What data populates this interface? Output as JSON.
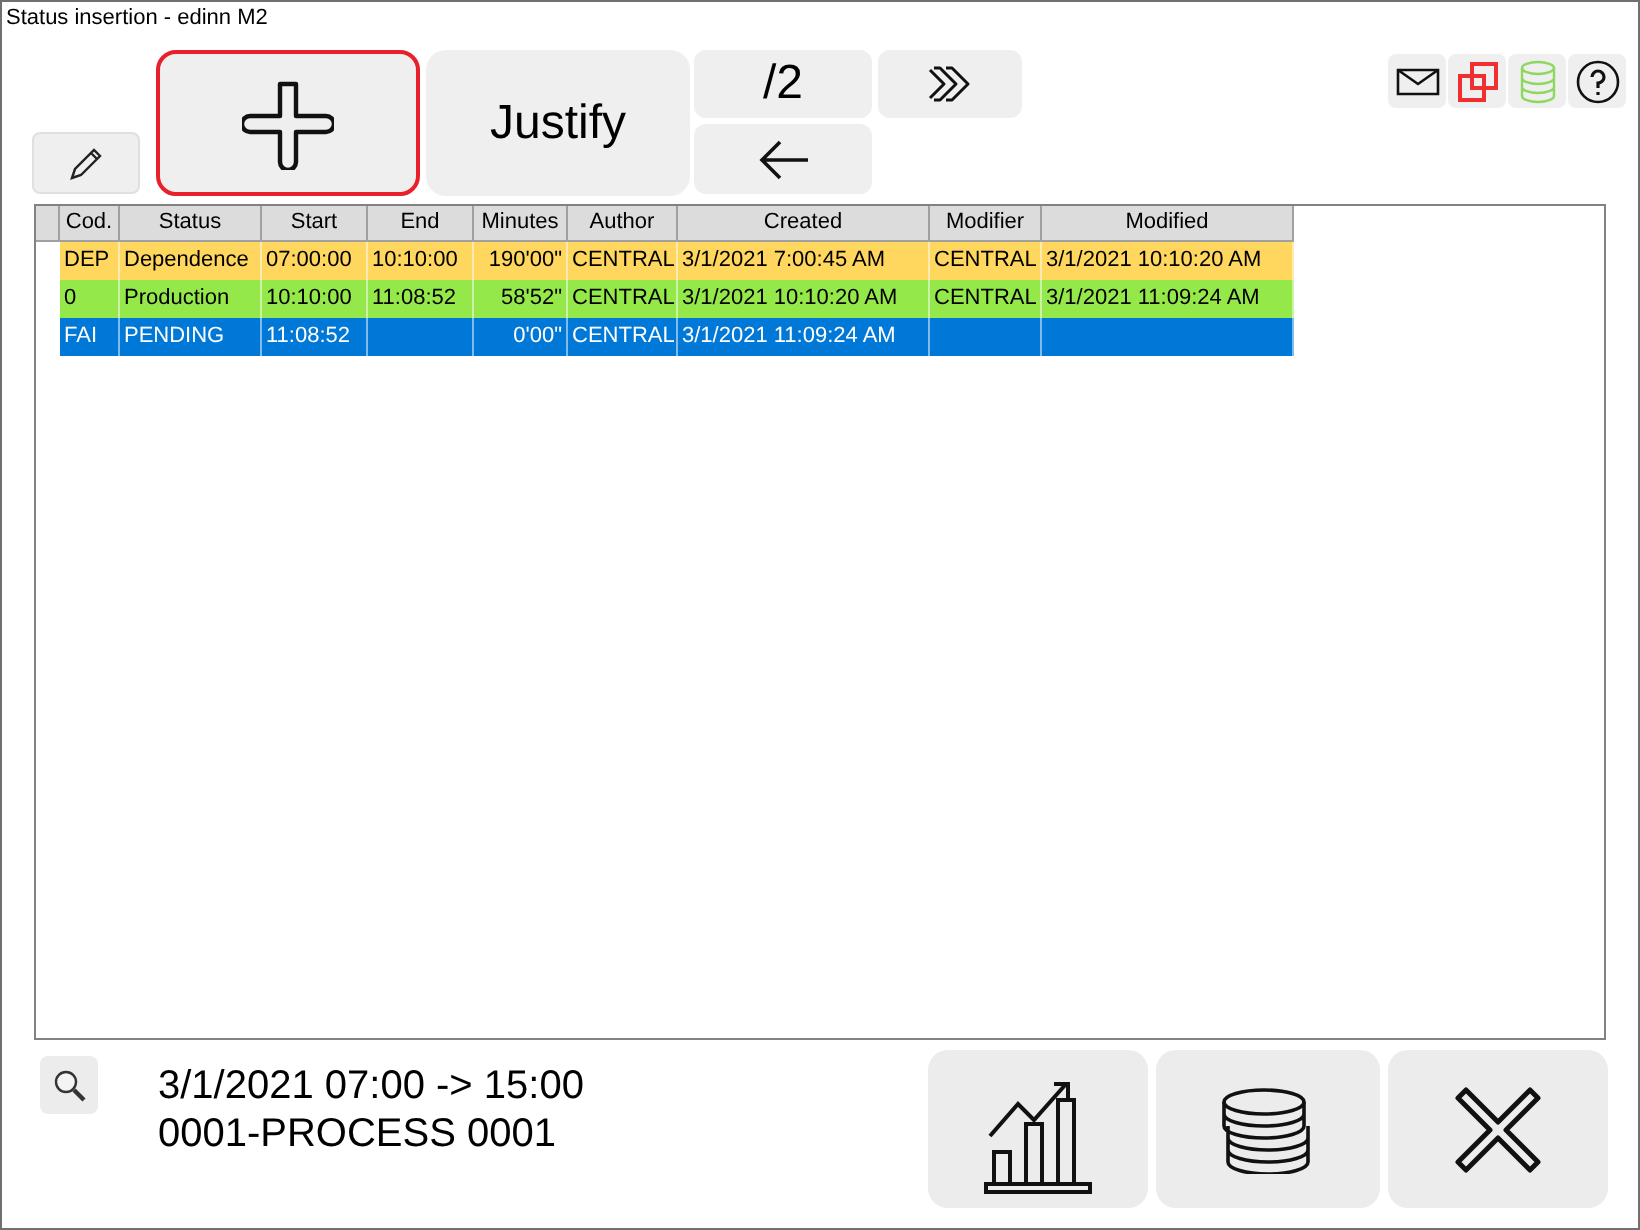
{
  "window": {
    "title": "Status insertion - edinn M2"
  },
  "toolbar": {
    "add_focused": true,
    "justify_label": "Justify",
    "divide_label": "/2"
  },
  "table": {
    "columns": [
      "Cod.",
      "Status",
      "Start",
      "End",
      "Minutes",
      "Author",
      "Created",
      "Modifier",
      "Modified"
    ],
    "rows": [
      {
        "cells": [
          "DEP",
          "Dependence",
          "07:00:00",
          "10:10:00",
          "190'00\"",
          "CENTRAL",
          "3/1/2021 7:00:45 AM",
          "CENTRAL",
          "3/1/2021 10:10:20 AM"
        ],
        "color": "#ffd75e",
        "selected": false
      },
      {
        "cells": [
          "0",
          "Production",
          "10:10:00",
          "11:08:52",
          "58'52\"",
          "CENTRAL",
          "3/1/2021 10:10:20 AM",
          "CENTRAL",
          "3/1/2021 11:09:24 AM"
        ],
        "color": "#95e84a",
        "selected": false
      },
      {
        "cells": [
          "FAI",
          "PENDING",
          "11:08:52",
          "",
          "0'00\"",
          "CENTRAL",
          "3/1/2021 11:09:24 AM",
          "",
          ""
        ],
        "color": "#0078d7",
        "selected": true
      }
    ]
  },
  "footer": {
    "date_range": "3/1/2021 07:00 -> 15:00",
    "process": "0001-PROCESS 0001"
  }
}
